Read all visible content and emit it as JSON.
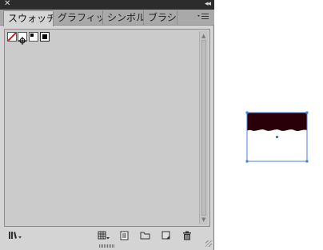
{
  "panel": {
    "close_glyph": "✕",
    "collapse_glyph": "◂◂",
    "tabs": [
      {
        "label": "スウォッチ",
        "active": true
      },
      {
        "label": "グラフィッ",
        "active": false
      },
      {
        "label": "シンボル",
        "active": false
      },
      {
        "label": "ブラシ",
        "active": false
      }
    ],
    "swatches": [
      {
        "name": "None"
      },
      {
        "name": "Registration"
      },
      {
        "name": "White"
      },
      {
        "name": "Black"
      }
    ]
  },
  "artwork": {
    "fill_color": "#2a0008",
    "selection_color": "#4a7de0"
  }
}
